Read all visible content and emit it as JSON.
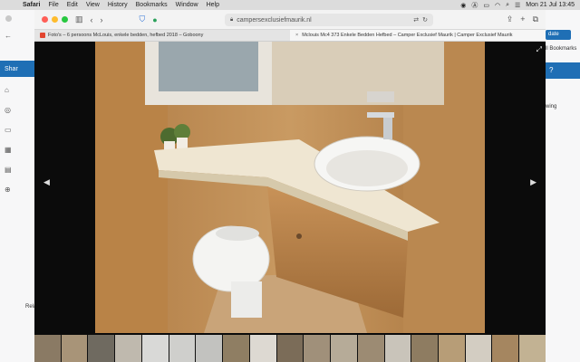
{
  "menubar": {
    "app": "Safari",
    "menus": [
      "File",
      "Edit",
      "View",
      "History",
      "Bookmarks",
      "Window",
      "Help"
    ],
    "clock": "Mon 21 Jul  13:45"
  },
  "toolbar": {
    "url": "campersexclusiefmaurik.nl"
  },
  "tabs": [
    {
      "title": "Foto's – 6 persoons McLouis, enkele bedden, hefbed 2018 – Goboony",
      "active": false
    },
    {
      "title": "Mclouis Mc4 373 Enkele Bedden Hefbed – Camper Exclusief Maurik | Camper Exclusief Maurik",
      "active": true
    }
  ],
  "background_page": {
    "left_sidebar_label": "Shar",
    "right_update_button": "date",
    "right_bookmarks": "ll Bookmarks",
    "right_text": "wing",
    "left_bottom_label": "Relat"
  },
  "lightbox": {
    "prev_label": "◀",
    "next_label": "▶"
  },
  "colors": {
    "accent": "#1f6fb5",
    "traffic_red": "#ff5f57",
    "traffic_yellow": "#febc2e",
    "traffic_green": "#28c840"
  }
}
